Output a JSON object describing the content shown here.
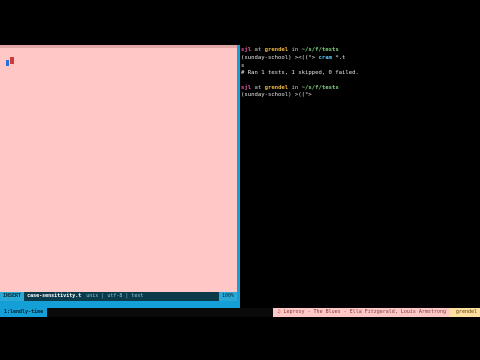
{
  "editor": {
    "mode": "INSERT",
    "filename": "case-sensitivity.t",
    "info": "unix | utf-8 | text",
    "position": "100%"
  },
  "terminal": {
    "prompt1": {
      "user": "sjl",
      "at": " at ",
      "host": "grendel",
      "in": " in ",
      "path": "~/s/f/tests"
    },
    "branch1": "(sunday-school)",
    "symbol1": " ><((°>",
    "command": " cram",
    "command_arg": " *.t",
    "output_dot": "s",
    "result": "# Ran 1 tests, 1 skipped, 0 failed.",
    "prompt2": {
      "user": "sjl",
      "at": " at ",
      "host": "grendel",
      "in": " in ",
      "path": "~/s/f/tests"
    },
    "branch2": "(sunday-school)",
    "symbol2": " >((°>"
  },
  "tmux": {
    "session": "1:lendly-time",
    "now_playing": "♫ Leprosy - The Blues - Ella Fitzgerald, Louis Armstrong",
    "host": "grendel"
  }
}
